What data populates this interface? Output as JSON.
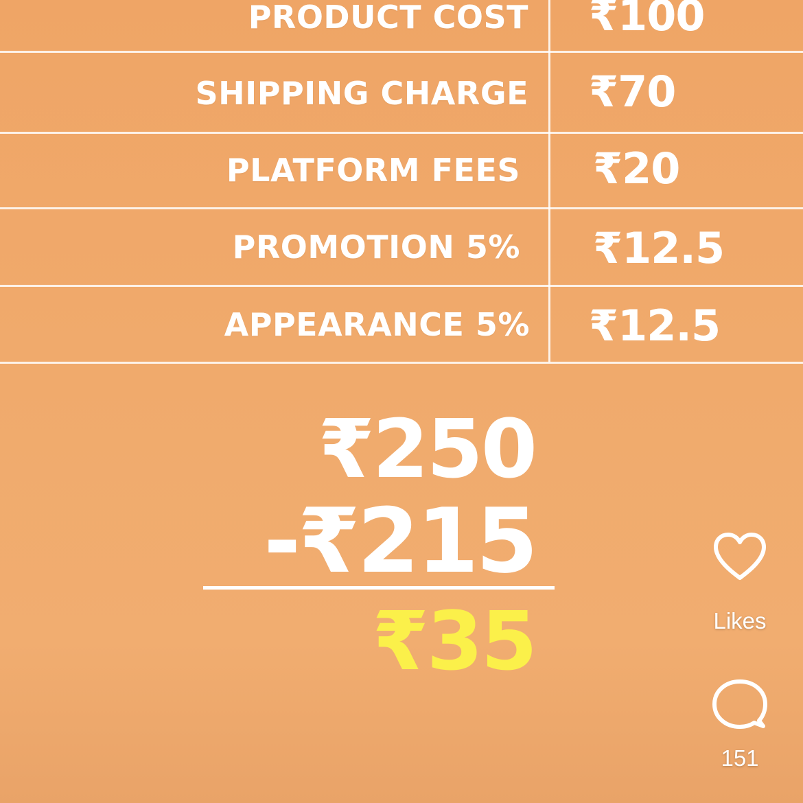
{
  "cost_table": {
    "rows": [
      {
        "label": "PRODUCT COST",
        "value": "₹100"
      },
      {
        "label": "SHIPPING CHARGE",
        "value": "₹70"
      },
      {
        "label": "PLATFORM FEES",
        "value": "₹20"
      },
      {
        "label": "PROMOTION 5%",
        "value": "₹12.5"
      },
      {
        "label": "APPEARANCE 5%",
        "value": "₹12.5"
      }
    ]
  },
  "calculation": {
    "total": "₹250",
    "subtract": "-₹215",
    "result": "₹35"
  },
  "actions": {
    "likes": {
      "icon": "heart-icon",
      "label": "Likes"
    },
    "comments": {
      "icon": "comment-icon",
      "count": "151"
    }
  },
  "colors": {
    "background": "#efa566",
    "text": "#ffffff",
    "result": "#fbf04a"
  }
}
